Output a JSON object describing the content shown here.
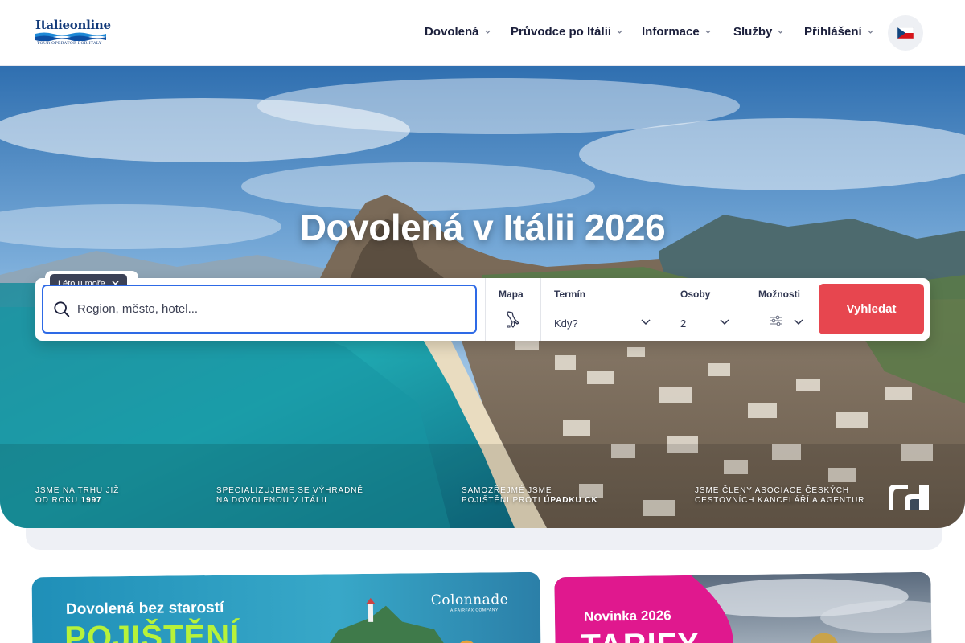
{
  "header": {
    "logo_text": "Italieonline",
    "logo_tagline": "TOUR OPERATOR FOR ITALY",
    "nav": [
      {
        "label": "Dovolená"
      },
      {
        "label": "Průvodce po Itálii"
      },
      {
        "label": "Informace"
      },
      {
        "label": "Služby"
      },
      {
        "label": "Přihlášení"
      }
    ],
    "language_icon": "czech-flag-icon"
  },
  "hero": {
    "title": "Dovolená v Itálii 2026"
  },
  "search": {
    "chip_label": "Léto u moře",
    "placeholder": "Region, město, hotel...",
    "map_label": "Mapa",
    "term_label": "Termín",
    "term_value": "Kdy?",
    "persons_label": "Osoby",
    "persons_value": "2",
    "options_label": "Možnosti",
    "submit_label": "Vyhledat"
  },
  "trust": [
    {
      "line1": "JSME NA TRHU JIŽ",
      "line2_prefix": "OD ROKU ",
      "line2_bold": "1997"
    },
    {
      "line1": "SPECIALIZUJEME SE VÝHRADNĚ",
      "line2_prefix": "NA DOVOLENOU V ITÁLII",
      "line2_bold": ""
    },
    {
      "line1": "SAMOZŘEJMÉ JSME",
      "line2_prefix": "POJIŠTĚNI PROTI ",
      "line2_bold": "ÚPADKU CK"
    },
    {
      "line1": "JSME ČLENY ASOCIACE ČESKÝCH",
      "line2_prefix": "CESTOVNÍCH KANCELÁŘÍ A AGENTUR",
      "line2_bold": ""
    }
  ],
  "promos": [
    {
      "title": "Dovolená bez starostí",
      "big": "POJIŠTĚNÍ",
      "brand": "Colonnade",
      "brand_sub": "A FAIRFAX COMPANY"
    },
    {
      "title": "Novinka 2026",
      "big": "TARIFY"
    }
  ],
  "colors": {
    "accent_red": "#e7464f",
    "focus_blue": "#2e6ae6",
    "promo_green": "#b7f23a",
    "promo_pink": "#e0188e"
  }
}
